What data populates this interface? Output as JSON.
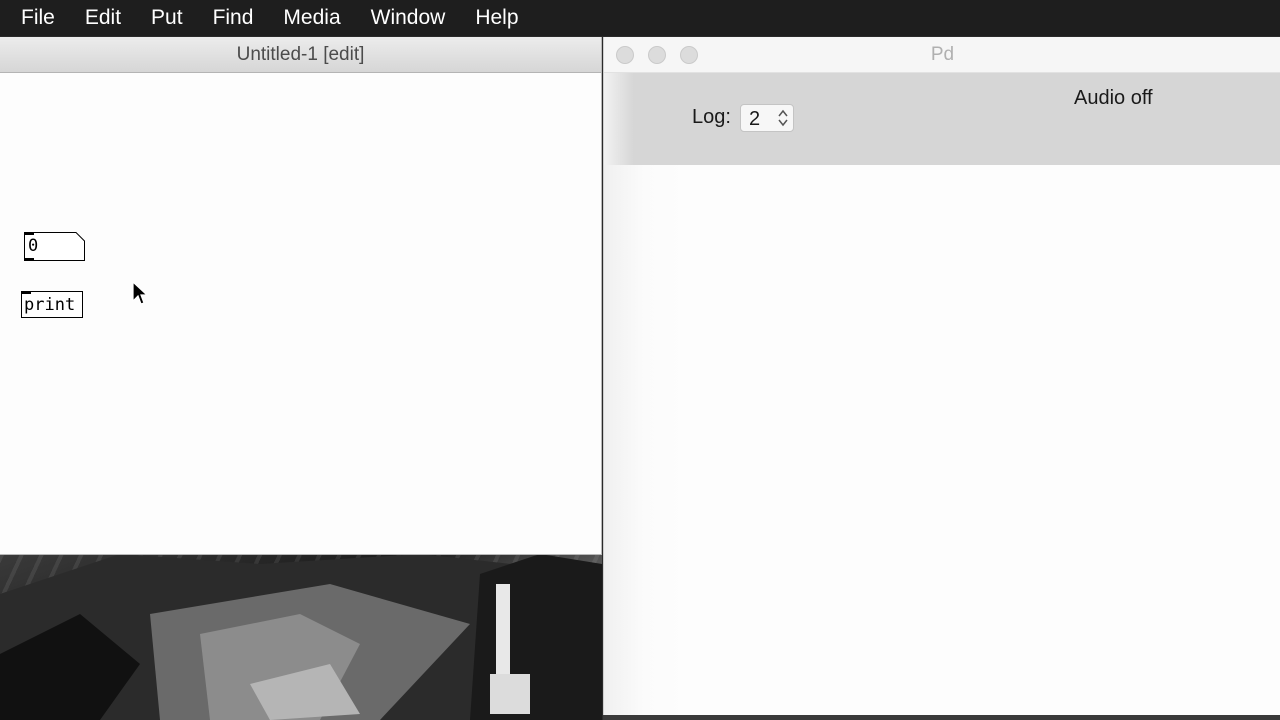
{
  "menubar": {
    "items": [
      "File",
      "Edit",
      "Put",
      "Find",
      "Media",
      "Window",
      "Help"
    ]
  },
  "patch_window": {
    "title": "Untitled-1 [edit]",
    "number_box": {
      "value": "0"
    },
    "object_box": {
      "label": "print"
    }
  },
  "pd_window": {
    "title": "Pd",
    "log_label": "Log:",
    "log_value": "2",
    "audio_status": "Audio off"
  }
}
